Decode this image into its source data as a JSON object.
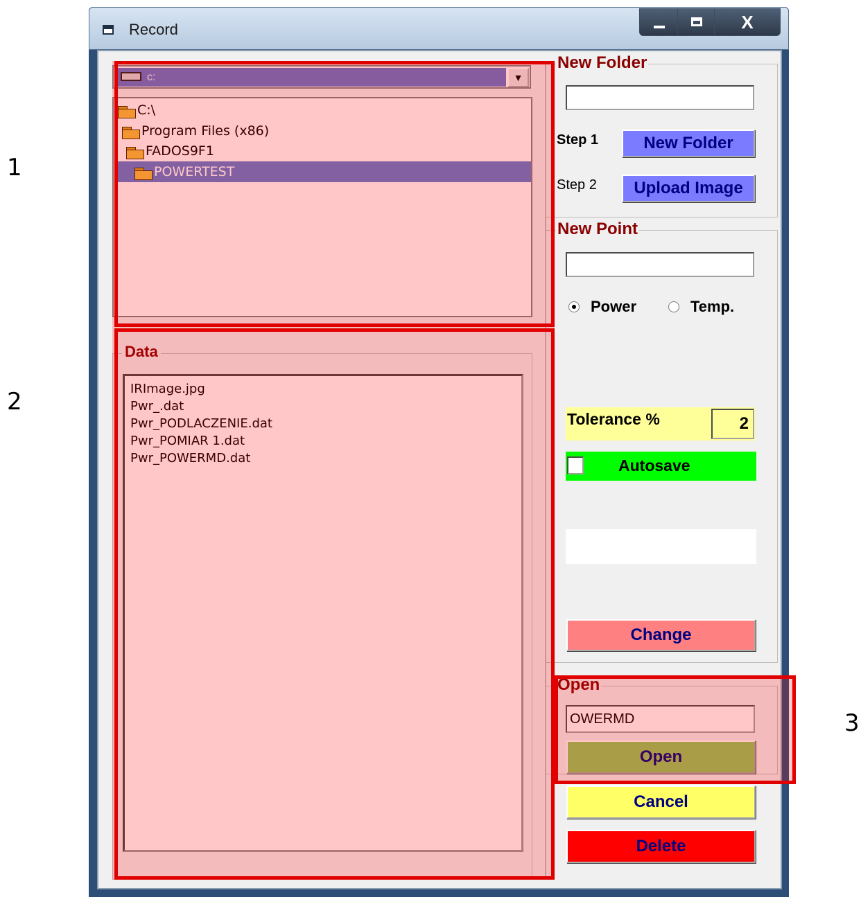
{
  "window": {
    "title": "Record",
    "minimize": "",
    "maximize": "",
    "close": "X"
  },
  "drive": {
    "label": "c:"
  },
  "tree": [
    "C:\\",
    "Program Files (x86)",
    "FADOS9F1",
    "POWERTEST"
  ],
  "data": {
    "legend": "Data",
    "files": [
      "IRImage.jpg",
      "Pwr_.dat",
      "Pwr_PODLACZENIE.dat",
      "Pwr_POMIAR 1.dat",
      "Pwr_POWERMD.dat"
    ]
  },
  "new_folder": {
    "legend": "New Folder",
    "input_value": "",
    "step1": "Step 1",
    "step1_button": "New Folder",
    "step2": "Step 2",
    "step2_button": "Upload Image"
  },
  "new_point": {
    "legend": "New Point",
    "input_value": "",
    "radio_power": "Power",
    "radio_temp": "Temp.",
    "selected": "Power",
    "tolerance_label": "Tolerance %",
    "tolerance_value": "2",
    "autosave_label": "Autosave",
    "change_button": "Change"
  },
  "open": {
    "legend": "Open",
    "input_value": "OWERMD",
    "open_button": "Open"
  },
  "cancel_button": "Cancel",
  "delete_button": "Delete",
  "markers": [
    "1",
    "2",
    "3"
  ],
  "colors": {
    "legend_text": "#8b0000",
    "button_blue": "#7b7bff",
    "tolerance_yellow": "#ffff99",
    "autosave_green": "#00ff00",
    "change_red": "#ff8080",
    "open_green": "#92c95c",
    "cancel_yellow": "#ffff66",
    "delete_red": "#ff0000",
    "highlight_frame": "#e00000"
  }
}
